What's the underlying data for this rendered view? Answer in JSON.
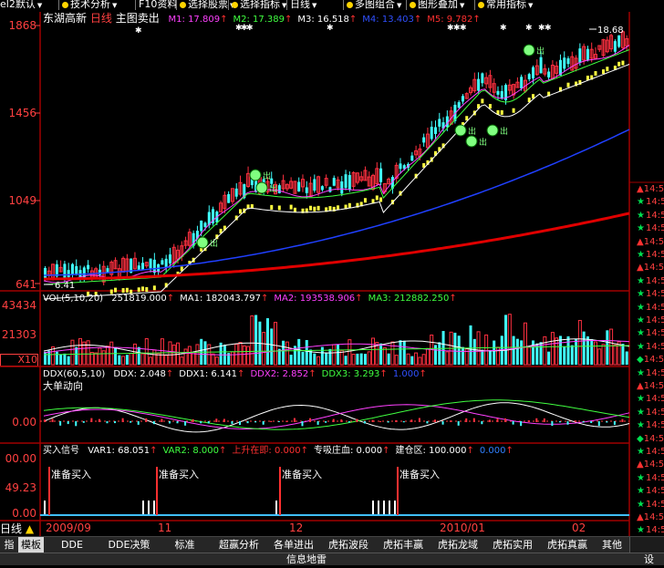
{
  "menu": {
    "items": [
      {
        "label": "el2默认",
        "dropdown": true
      },
      {
        "label": "技术分析",
        "dropdown": true
      },
      {
        "label": "F10资料",
        "dropdown": false
      },
      {
        "label": "选择股票",
        "dropdown": true
      },
      {
        "label": "选择指标",
        "dropdown": true
      },
      {
        "label": "日线",
        "dropdown": true
      },
      {
        "label": "多图组合",
        "dropdown": true
      },
      {
        "label": "图形叠加",
        "dropdown": true
      },
      {
        "label": "常用指标",
        "dropdown": true
      }
    ]
  },
  "main_chart": {
    "stock_name": "东湖高新",
    "period": "日线",
    "indicator": "主图卖出",
    "ma_labels": [
      {
        "text": "M1: 17.809",
        "color": "#ff40ff"
      },
      {
        "text": "M2: 17.389",
        "color": "#40ff40"
      },
      {
        "text": "M3: 16.518",
        "color": "#ffffff"
      },
      {
        "text": "M4: 13.403",
        "color": "#3050ff"
      },
      {
        "text": "M5: 9.782",
        "color": "#ff3030"
      }
    ],
    "y_ticks": [
      "1868",
      "1456",
      "1049",
      "641"
    ],
    "high_marker": "18.68",
    "low_marker": "6.41",
    "badge_label": "出"
  },
  "vol_panel": {
    "title": "VOL(5,10,20)",
    "values": [
      {
        "text": "251819.000",
        "color": "#ffffff"
      },
      {
        "text": "MA1: 182043.797",
        "color": "#ffffff"
      },
      {
        "text": "MA2: 193538.906",
        "color": "#ff40ff"
      },
      {
        "text": "MA3: 212882.250",
        "color": "#40ff40"
      }
    ],
    "y_ticks": [
      "43434",
      "21303",
      "X10"
    ]
  },
  "ddx_panel": {
    "title": "DDX(60,5,10)",
    "values": [
      {
        "text": "DDX: 2.048",
        "color": "#ffffff"
      },
      {
        "text": "DDX1: 6.141",
        "color": "#ffffff"
      },
      {
        "text": "DDX2: 2.852",
        "color": "#ff40ff"
      },
      {
        "text": "DDX3: 3.293",
        "color": "#40ff40"
      },
      {
        "text": "1.000",
        "color": "#3050ff"
      }
    ],
    "subtitle": "大单动向",
    "y_ticks": [
      "0.00"
    ]
  },
  "signal_panel": {
    "title": "买入信号",
    "values": [
      {
        "text": "VAR1: 68.051",
        "color": "#ffffff"
      },
      {
        "text": "VAR2: 8.000",
        "color": "#40ff40"
      },
      {
        "text": "上升在即: 0.000",
        "color": "#ff3030"
      },
      {
        "text": "专吸庄血: 0.000",
        "color": "#ffffff"
      },
      {
        "text": "建仓区: 100.000",
        "color": "#ffffff"
      },
      {
        "text": "0.000",
        "color": "#3080ff"
      }
    ],
    "y_ticks": [
      "00.00",
      "49.23",
      "0.00"
    ],
    "signal_label": "准备买入"
  },
  "date_axis": {
    "labels": [
      "2009/09",
      "11",
      "12",
      "2010/01",
      "02"
    ]
  },
  "corner_label": "日线",
  "tabs": [
    {
      "label": "指标",
      "active": false
    },
    {
      "label": "模板",
      "active": true
    },
    {
      "label": "DDE",
      "active": false
    },
    {
      "label": "DDE决策",
      "active": false
    },
    {
      "label": "标准",
      "active": false
    },
    {
      "label": "超赢分析",
      "active": false
    },
    {
      "label": "各单进出",
      "active": false
    },
    {
      "label": "虎拓波段",
      "active": false
    },
    {
      "label": "虎拓丰赢",
      "active": false
    },
    {
      "label": "虎拓龙域",
      "active": false
    },
    {
      "label": "虎拓实用",
      "active": false
    },
    {
      "label": "虎拓真赢",
      "active": false
    },
    {
      "label": "其他",
      "active": false
    }
  ],
  "status": {
    "center": "信息地雷",
    "right": "设"
  },
  "right_list": {
    "prefix": "14:5",
    "markers": [
      "tri",
      "star",
      "star",
      "star",
      "tri",
      "star",
      "tri",
      "star",
      "star",
      "star",
      "star",
      "star",
      "star",
      "dia",
      "star",
      "tri",
      "star",
      "star",
      "star",
      "dia",
      "star",
      "tri",
      "star",
      "star",
      "star",
      "tri",
      "star",
      "tri",
      "star",
      "star",
      "star",
      "star",
      "star",
      "star",
      "star",
      "star",
      "star",
      "star"
    ]
  },
  "colors": {
    "frame": "#a00000",
    "up": "#ff3040",
    "down": "#40ffff",
    "ma_white": "#ffffff",
    "ma_yellow": "#ffff40",
    "ma_blue": "#2040ff",
    "ma_red": "#e00000"
  }
}
